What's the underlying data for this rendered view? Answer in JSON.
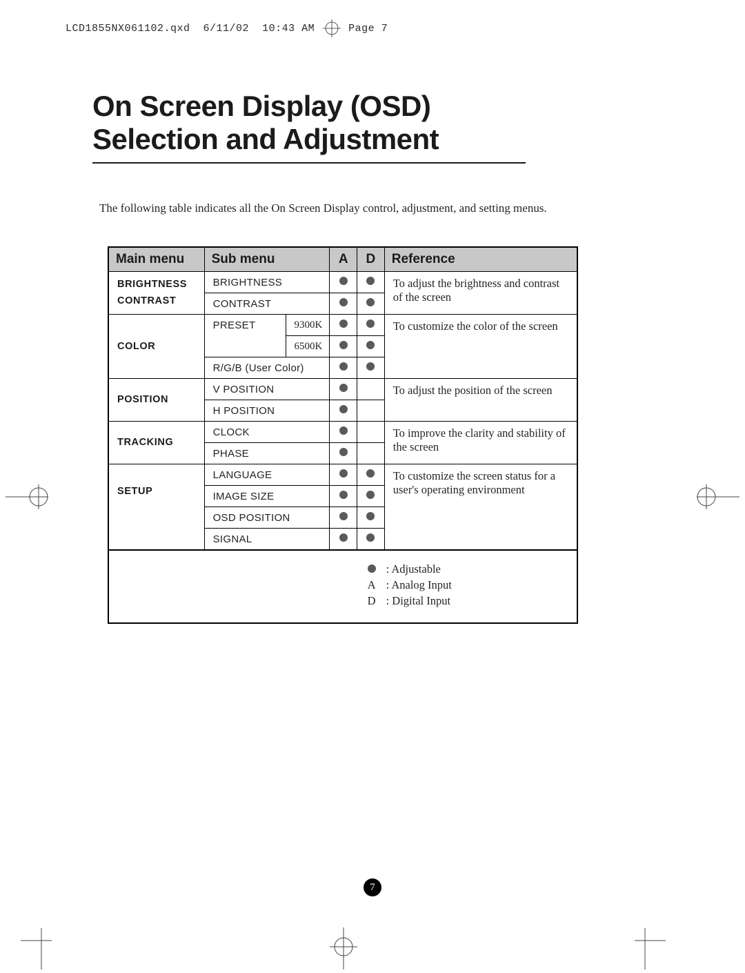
{
  "print_header": {
    "filename": "LCD1855NX061102.qxd",
    "date": "6/11/02",
    "time": "10:43 AM",
    "page_label": "Page 7"
  },
  "title_line1": "On Screen Display (OSD)",
  "title_line2": "Selection and Adjustment",
  "intro": "The following table indicates all the On Screen Display control, adjustment, and setting menus.",
  "headers": {
    "main": "Main menu",
    "sub": "Sub menu",
    "a": "A",
    "d": "D",
    "ref": "Reference"
  },
  "rows": {
    "brightness_contrast": {
      "main": "BRIGHTNESS\nCONTRAST",
      "items": [
        {
          "sub": "BRIGHTNESS",
          "a": true,
          "d": true
        },
        {
          "sub": "CONTRAST",
          "a": true,
          "d": true
        }
      ],
      "ref": "To adjust the brightness and contrast of the screen"
    },
    "color": {
      "main": "COLOR",
      "preset_label": "PRESET",
      "presets": [
        {
          "sub": "9300K",
          "a": true,
          "d": true
        },
        {
          "sub": "6500K",
          "a": true,
          "d": true
        }
      ],
      "rgb": {
        "sub": "R/G/B (User Color)",
        "a": true,
        "d": true
      },
      "ref": "To customize the color of the screen"
    },
    "position": {
      "main": "POSITION",
      "items": [
        {
          "sub": "V POSITION",
          "a": true,
          "d": false
        },
        {
          "sub": "H POSITION",
          "a": true,
          "d": false
        }
      ],
      "ref": "To adjust the position of the screen"
    },
    "tracking": {
      "main": "TRACKING",
      "items": [
        {
          "sub": "CLOCK",
          "a": true,
          "d": false
        },
        {
          "sub": "PHASE",
          "a": true,
          "d": false
        }
      ],
      "ref": "To improve the clarity and stability of the screen"
    },
    "setup": {
      "main": "SETUP",
      "items": [
        {
          "sub": "LANGUAGE",
          "a": true,
          "d": true
        },
        {
          "sub": "IMAGE SIZE",
          "a": true,
          "d": true
        },
        {
          "sub": "OSD POSITION",
          "a": true,
          "d": true
        },
        {
          "sub": "SIGNAL",
          "a": true,
          "d": true
        }
      ],
      "ref": "To customize the screen status for a user's operating environment"
    }
  },
  "legend": {
    "adjustable": ": Adjustable",
    "a_key": "A",
    "a_val": ": Analog Input",
    "d_key": "D",
    "d_val": ": Digital Input"
  },
  "page_number": "7"
}
